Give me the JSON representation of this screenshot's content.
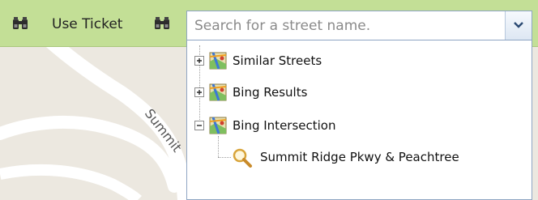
{
  "toolbar": {
    "use_ticket_label": "Use Ticket",
    "use_ticket_icon": "binoculars-icon",
    "search_icon": "binoculars-icon"
  },
  "search": {
    "value": "",
    "placeholder": "Search for a street name.",
    "dropdown_icon": "chevron-down-icon"
  },
  "tree": {
    "groups": [
      {
        "label": "Similar Streets",
        "expanded": false,
        "icon": "map-folder-icon"
      },
      {
        "label": "Bing Results",
        "expanded": false,
        "icon": "map-folder-icon"
      },
      {
        "label": "Bing Intersection",
        "expanded": true,
        "icon": "map-folder-icon",
        "children": [
          {
            "label": "Summit Ridge Pkwy & Peachtree",
            "icon": "magnifier-icon"
          }
        ]
      }
    ]
  },
  "map": {
    "street_label": "Summit"
  },
  "colors": {
    "toolbar_bg": "#c3df96",
    "map_bg": "#ece8e0",
    "road": "#ffffff",
    "input_border": "#8ea5c3"
  }
}
